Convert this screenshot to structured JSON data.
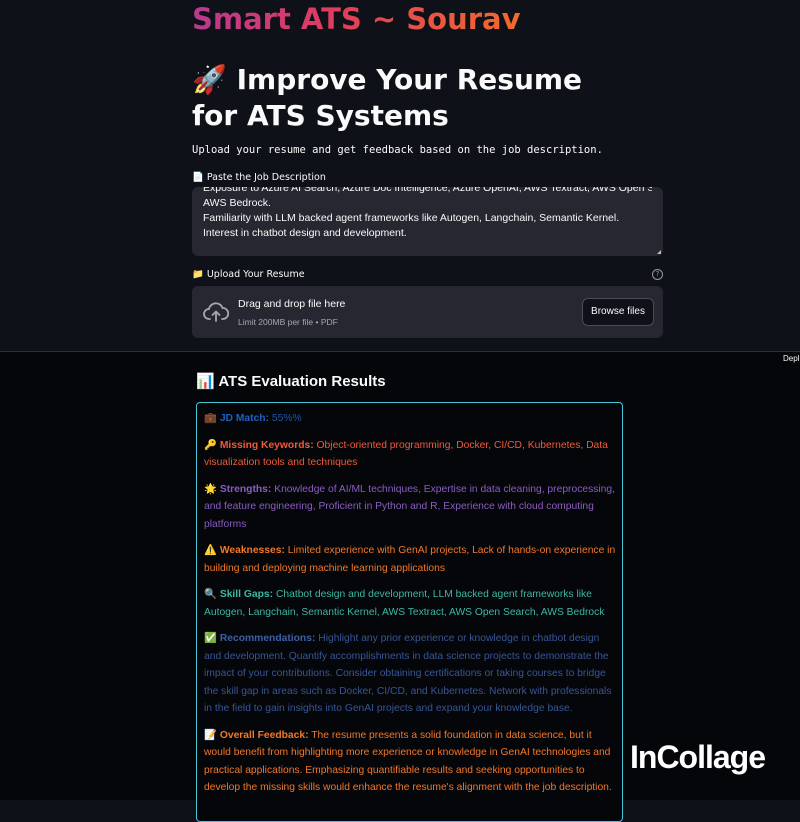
{
  "app": {
    "title": "Smart ATS ~ Sourav",
    "heading_emoji": "🚀",
    "heading": "Improve Your Resume for ATS Systems",
    "subtitle": "Upload your resume and get feedback based on the job description."
  },
  "job_description": {
    "label_icon": "📄",
    "label": "Paste the Job Description",
    "visible_lines": [
      "Exposure to Azure AI Search, Azure Doc Intelligence, Azure OpenAI, AWS Textract, AWS Open Search,",
      "AWS Bedrock.",
      "Familiarity with LLM backed agent frameworks like Autogen, Langchain, Semantic Kernel.",
      "Interest in chatbot design and development."
    ]
  },
  "upload": {
    "label_icon": "📁",
    "label": "Upload Your Resume",
    "help_icon": "?",
    "drag_text": "Drag and drop file here",
    "limit_text": "Limit 200MB per file • PDF",
    "browse_label": "Browse files"
  },
  "header": {
    "deploy_label": "Depl"
  },
  "results": {
    "title_icon": "📊",
    "title": "ATS Evaluation Results",
    "sections": [
      {
        "emoji": "💼",
        "key": "JD Match:",
        "value": "55%%",
        "color": "#1f5fbf"
      },
      {
        "emoji": "🔑",
        "key": "Missing Keywords:",
        "value": "Object-oriented programming, Docker, CI/CD, Kubernetes, Data visualization tools and techniques",
        "color": "#f05a3a"
      },
      {
        "emoji": "🌟",
        "key": "Strengths:",
        "value": "Knowledge of AI/ML techniques, Expertise in data cleaning, preprocessing, and feature engineering, Proficient in Python and R, Experience with cloud computing platforms",
        "color": "#8a5cc2"
      },
      {
        "emoji": "⚠️",
        "key": "Weaknesses:",
        "value": "Limited experience with GenAI projects, Lack of hands-on experience in building and deploying machine learning applications",
        "color": "#f2782a"
      },
      {
        "emoji": "🔍",
        "key": "Skill Gaps:",
        "value": "Chatbot design and development, LLM backed agent frameworks like Autogen, Langchain, Semantic Kernel, AWS Textract, AWS Open Search, AWS Bedrock",
        "color": "#3cb8a5"
      },
      {
        "emoji": "✅",
        "key": "Recommendations:",
        "value": "Highlight any prior experience or knowledge in chatbot design and development. Quantify accomplishments in data science projects to demonstrate the impact of your contributions. Consider obtaining certifications or taking courses to bridge the skill gap in areas such as Docker, CI/CD, and Kubernetes. Network with professionals in the field to gain insights into GenAI projects and expand your knowledge base.",
        "color": "#3d5fa6"
      },
      {
        "emoji": "📝",
        "key": "Overall Feedback:",
        "value": "The resume presents a solid foundation in data science, but it would benefit from highlighting more experience or knowledge in GenAI technologies and practical applications. Emphasizing quantifiable results and seeking opportunities to develop the missing skills would enhance the resume's alignment with the job description.",
        "color": "#f2782a"
      }
    ]
  },
  "watermark": {
    "text": "InCollage"
  }
}
